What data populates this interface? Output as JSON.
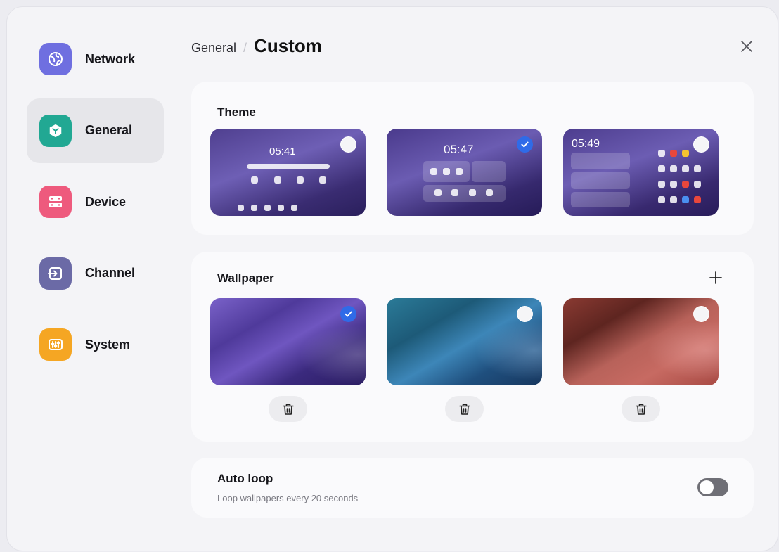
{
  "sidebar": {
    "items": [
      {
        "label": "Network",
        "icon": "globe-icon",
        "color": "#6f6fe0",
        "active": false
      },
      {
        "label": "General",
        "icon": "cube-icon",
        "color": "#21a893",
        "active": true
      },
      {
        "label": "Device",
        "icon": "server-icon",
        "color": "#ee5a7d",
        "active": false
      },
      {
        "label": "Channel",
        "icon": "input-icon",
        "color": "#6b6aa6",
        "active": false
      },
      {
        "label": "System",
        "icon": "sliders-icon",
        "color": "#f5a623",
        "active": false
      }
    ]
  },
  "header": {
    "parent": "General",
    "separator": "/",
    "title": "Custom"
  },
  "theme": {
    "title": "Theme",
    "options": [
      {
        "time": "05:41",
        "selected": false
      },
      {
        "time": "05:47",
        "selected": true
      },
      {
        "time": "05:49",
        "selected": false
      }
    ]
  },
  "wallpaper": {
    "title": "Wallpaper",
    "options": [
      {
        "style": "purple",
        "selected": true
      },
      {
        "style": "teal",
        "selected": false
      },
      {
        "style": "red",
        "selected": false
      }
    ]
  },
  "autoloop": {
    "title": "Auto loop",
    "subtitle": "Loop wallpapers every 20 seconds",
    "enabled": false
  },
  "colors": {
    "accent": "#2f6be8"
  }
}
